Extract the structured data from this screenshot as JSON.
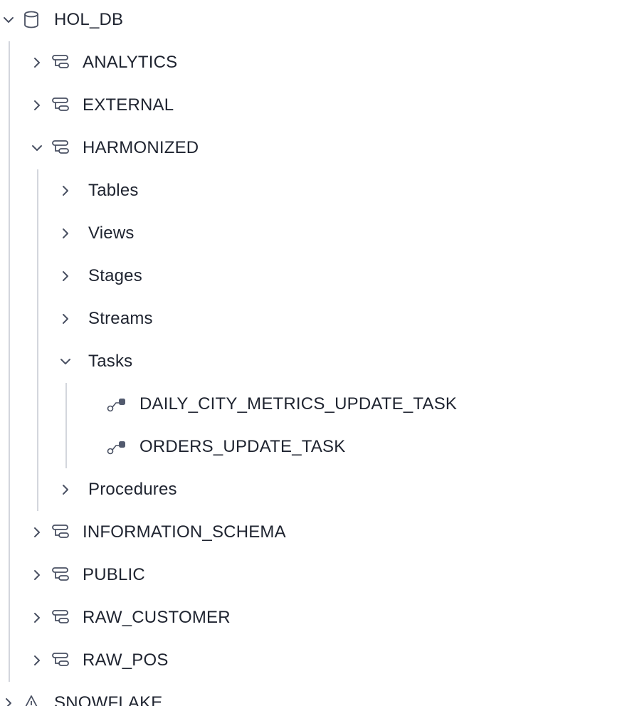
{
  "tree": {
    "database": {
      "label": "HOL_DB",
      "expanded": true,
      "icon": "database-icon"
    },
    "schemas": [
      {
        "label": "ANALYTICS",
        "expanded": false,
        "icon": "schema-icon"
      },
      {
        "label": "EXTERNAL",
        "expanded": false,
        "icon": "schema-icon"
      },
      {
        "label": "HARMONIZED",
        "expanded": true,
        "icon": "schema-icon"
      },
      {
        "label": "INFORMATION_SCHEMA",
        "expanded": false,
        "icon": "schema-icon"
      },
      {
        "label": "PUBLIC",
        "expanded": false,
        "icon": "schema-icon"
      },
      {
        "label": "RAW_CUSTOMER",
        "expanded": false,
        "icon": "schema-icon"
      },
      {
        "label": "RAW_POS",
        "expanded": false,
        "icon": "schema-icon"
      }
    ],
    "harmonized_groups": [
      {
        "label": "Tables",
        "expanded": false
      },
      {
        "label": "Views",
        "expanded": false
      },
      {
        "label": "Stages",
        "expanded": false
      },
      {
        "label": "Streams",
        "expanded": false
      },
      {
        "label": "Tasks",
        "expanded": true
      },
      {
        "label": "Procedures",
        "expanded": false
      }
    ],
    "tasks": [
      {
        "label": "DAILY_CITY_METRICS_UPDATE_TASK",
        "icon": "task-icon"
      },
      {
        "label": "ORDERS_UPDATE_TASK",
        "icon": "task-icon"
      }
    ],
    "next_database": {
      "label": "SNOWFLAKE",
      "expanded": false,
      "icon": "shared-database-icon"
    }
  },
  "colors": {
    "text": "#1f2430",
    "icon": "#4a5163",
    "guide": "#d3d6dd",
    "task_dot": "#525a6e"
  }
}
